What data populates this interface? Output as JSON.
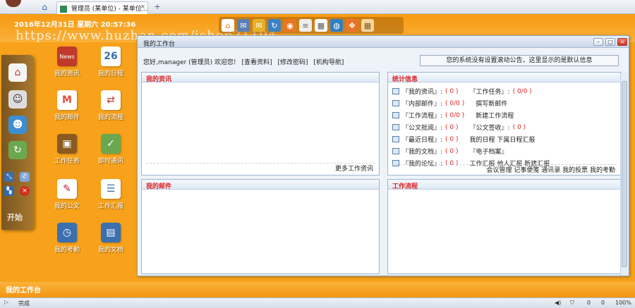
{
  "browser": {
    "tab_title": "管理员 (某单位) - 某单位...",
    "status_text": "完成",
    "status_right": [
      "0",
      "0",
      "100%"
    ]
  },
  "header": {
    "datetime": "2016年12月31日 星期六 20:57:36",
    "watermark": "https://www.huzhan.com/ishop21194"
  },
  "toolbar_icons": [
    "home-icon",
    "mail-icon",
    "envelope-icon",
    "refresh-icon",
    "rss-icon",
    "note-icon",
    "calendar-icon",
    "globe-icon",
    "expand-icon",
    "grid-icon"
  ],
  "sidebar": {
    "label": "开始"
  },
  "desktop_icons": [
    {
      "name": "news",
      "label": "我的资讯",
      "icon": "News",
      "color": "#c0392b"
    },
    {
      "name": "schedule",
      "label": "我的日程",
      "icon": "26",
      "color": "#3b6fb0"
    },
    {
      "name": "mail",
      "label": "我的邮件",
      "icon": "M",
      "color": "#e74c3c"
    },
    {
      "name": "workflow",
      "label": "我的流程",
      "icon": "⇄",
      "color": "#c0392b"
    },
    {
      "name": "task",
      "label": "工作任务",
      "icon": "▣",
      "color": "#8a5a1e"
    },
    {
      "name": "im",
      "label": "即时通讯",
      "icon": "✓",
      "color": "#6aa84f"
    },
    {
      "name": "doc",
      "label": "我的公文",
      "icon": "✎",
      "color": "#b23"
    },
    {
      "name": "report",
      "label": "工作汇报",
      "icon": "☰",
      "color": "#3b6fb0"
    },
    {
      "name": "attendance",
      "label": "我的考勤",
      "icon": "◷",
      "color": "#3b6fb0"
    },
    {
      "name": "files",
      "label": "我的文档",
      "icon": "▤",
      "color": "#3b6fb0"
    }
  ],
  "window": {
    "title": "我的工作台",
    "welcome": [
      "您好,manager (管理员)  欢迎您!",
      "[查看资料]",
      "[修改密码]",
      "[机构导航]"
    ],
    "notice": "您的系统没有设置滚动公告，这里显示的是默认信息",
    "panels": {
      "news": {
        "title": "我的资讯",
        "footer": "更多工作资讯"
      },
      "stats": {
        "title": "统计信息"
      },
      "mail": {
        "title": "我的邮件"
      },
      "workflow": {
        "title": "工作流程"
      }
    },
    "stats_rows": [
      {
        "a": "『我的资讯』:",
        "a_cnt": "( 0 )",
        "b": "『工作任务』:",
        "b_cnt": "( 0/0 )"
      },
      {
        "a": "『内部邮件』:",
        "a_cnt": "( 0/0 )",
        "b": "撰写新邮件",
        "b_cnt": ""
      },
      {
        "a": "『工作流程』:",
        "a_cnt": "( 0/0 )",
        "b": "新建工作流程",
        "b_cnt": ""
      },
      {
        "a": "『公文批阅』:",
        "a_cnt": "( 0 )",
        "b": "『公文签收』:",
        "b_cnt": "( 0 )"
      },
      {
        "a": "『最近日程』:",
        "a_cnt": "( 0 )",
        "b": "我的日程  下属日程汇报",
        "b_cnt": ""
      },
      {
        "a": "『我的文档』:",
        "a_cnt": "( 0 )",
        "b": "『电子档案』",
        "b_cnt": ""
      },
      {
        "a": "『我的论坛』:",
        "a_cnt": "( 0 )",
        "b": "工作汇报  他人汇报  新建汇报",
        "b_cnt": ""
      }
    ],
    "stats_footer": "会议管理  记事便笺  通讯录  我的投票  我的考勤"
  },
  "taskbar": {
    "label": "我的工作台"
  }
}
